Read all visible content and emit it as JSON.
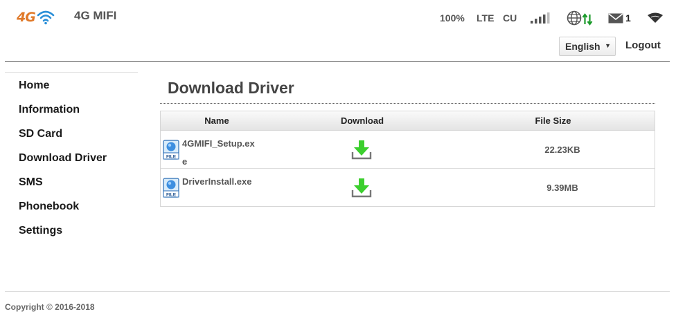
{
  "header": {
    "logo_text": "4G",
    "brand": "4G MIFI",
    "status": {
      "battery": "100%",
      "network_type": "LTE",
      "operator": "CU",
      "signal_icon": "signal-bars-icon",
      "internet_icon": "globe-icon",
      "data_icon": "data-transfer-icon",
      "mail_icon": "mail-icon",
      "mail_count": "1",
      "wifi_icon": "wifi-icon"
    },
    "language": "English",
    "logout": "Logout"
  },
  "sidebar": {
    "items": [
      {
        "label": "Home"
      },
      {
        "label": "Information"
      },
      {
        "label": "SD Card"
      },
      {
        "label": "Download Driver"
      },
      {
        "label": "SMS"
      },
      {
        "label": "Phonebook"
      },
      {
        "label": "Settings"
      }
    ]
  },
  "main": {
    "title": "Download Driver",
    "table": {
      "columns": [
        "Name",
        "Download",
        "File Size"
      ],
      "rows": [
        {
          "name": "4GMIFI_Setup.exe",
          "size": "22.23KB"
        },
        {
          "name": "DriverInstall.exe",
          "size": "9.39MB"
        }
      ]
    }
  },
  "footer": {
    "copyright": "Copyright © 2016-2018"
  },
  "colors": {
    "accent_orange": "#e07a2a",
    "wifi_blue": "#2a8fd8",
    "download_green": "#3ccf2e",
    "data_green": "#1a9a2a"
  }
}
